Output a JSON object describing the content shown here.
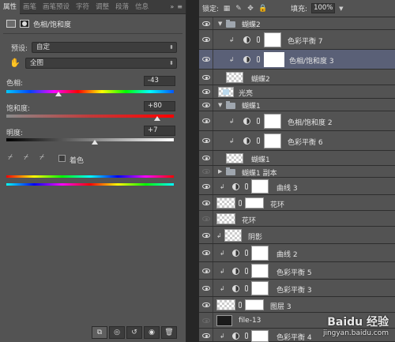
{
  "properties": {
    "tabs": [
      "属性",
      "画笔",
      "画笔预设",
      "字符",
      "调整",
      "段落",
      "信息"
    ],
    "panel_title": "色相/饱和度",
    "preset_label": "预设:",
    "preset_value": "自定",
    "channel_value": "全图",
    "hue_label": "色相:",
    "hue_value": "-43",
    "hue_position": 0.31,
    "saturation_label": "饱和度:",
    "saturation_value": "+80",
    "saturation_position": 0.9,
    "lightness_label": "明度:",
    "lightness_value": "+7",
    "lightness_position": 0.53,
    "colorize_label": "着色"
  },
  "layers_panel": {
    "lock_label": "锁定:",
    "fill_label": "填充:",
    "fill_value": "100%",
    "layers": [
      {
        "name": "蝴蝶2",
        "kind": "group"
      },
      {
        "name": "色彩平衡 7",
        "kind": "adjust"
      },
      {
        "name": "色相/饱和度 3",
        "kind": "adjust"
      },
      {
        "name": "蝴蝶2",
        "kind": "pixel"
      },
      {
        "name": "光亮",
        "kind": "pixel"
      },
      {
        "name": "蝴蝶1",
        "kind": "group"
      },
      {
        "name": "色相/饱和度 2",
        "kind": "adjust"
      },
      {
        "name": "色彩平衡 6",
        "kind": "adjust"
      },
      {
        "name": "蝴蝶1",
        "kind": "pixel"
      },
      {
        "name": "蝴蝶1 副本",
        "kind": "group"
      },
      {
        "name": "曲线 3",
        "kind": "adjust"
      },
      {
        "name": "花环",
        "kind": "pixel"
      },
      {
        "name": "花环",
        "kind": "pixel"
      },
      {
        "name": "阴影",
        "kind": "pixel"
      },
      {
        "name": "曲线 2",
        "kind": "adjust"
      },
      {
        "name": "色彩平衡 5",
        "kind": "adjust"
      },
      {
        "name": "色彩平衡 3",
        "kind": "adjust"
      },
      {
        "name": "图层 3",
        "kind": "pixel"
      },
      {
        "name": "file-13",
        "kind": "pixel"
      },
      {
        "name": "色彩平衡 4",
        "kind": "adjust"
      }
    ]
  },
  "watermark": {
    "brand": "Baidu 经验",
    "url": "jingyan.baidu.com"
  }
}
